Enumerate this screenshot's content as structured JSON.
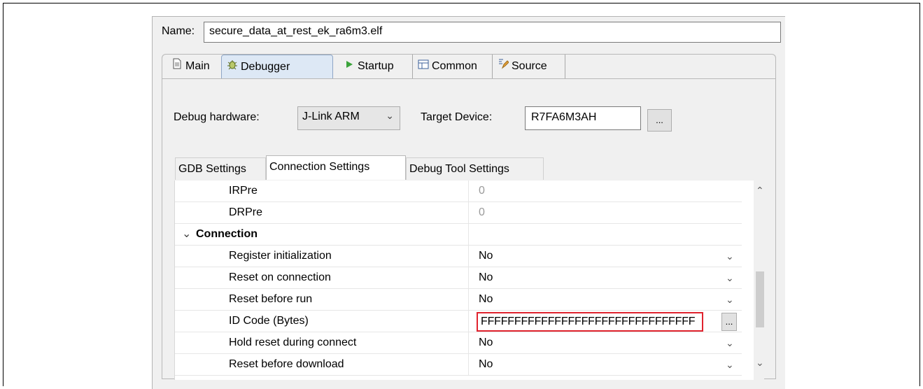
{
  "name": {
    "label": "Name:",
    "value": "secure_data_at_rest_ek_ra6m3.elf"
  },
  "tabs": [
    {
      "label": "Main",
      "icon": "document-icon",
      "active": false
    },
    {
      "label": "Debugger",
      "icon": "bug-icon",
      "active": true
    },
    {
      "label": "Startup",
      "icon": "play-icon",
      "active": false
    },
    {
      "label": "Common",
      "icon": "grid-icon",
      "active": false
    },
    {
      "label": "Source",
      "icon": "source-icon",
      "active": false
    }
  ],
  "debug_hardware": {
    "label": "Debug hardware:",
    "value": "J-Link ARM"
  },
  "target_device": {
    "label": "Target Device:",
    "value": "R7FA6M3AH",
    "browse": "..."
  },
  "subtabs": [
    {
      "label": "GDB Settings",
      "active": false
    },
    {
      "label": "Connection Settings",
      "active": true
    },
    {
      "label": "Debug Tool Settings",
      "active": false
    }
  ],
  "rows": [
    {
      "name": "IRPre",
      "value": "0",
      "disabled": true
    },
    {
      "name": "DRPre",
      "value": "0",
      "disabled": true
    },
    {
      "name": "Connection",
      "value": "",
      "group": true
    },
    {
      "name": "Register initialization",
      "value": "No"
    },
    {
      "name": "Reset on connection",
      "value": "No"
    },
    {
      "name": "Reset before run",
      "value": "No"
    },
    {
      "name": "ID Code (Bytes)",
      "value": "FFFFFFFFFFFFFFFFFFFFFFFFFFFFFFFF",
      "browse": "..."
    },
    {
      "name": "Hold reset during connect",
      "value": "No"
    },
    {
      "name": "Reset before download",
      "value": "No"
    }
  ],
  "colors": {
    "highlight": "#e0232e",
    "active_tab": "#dde8f5"
  }
}
